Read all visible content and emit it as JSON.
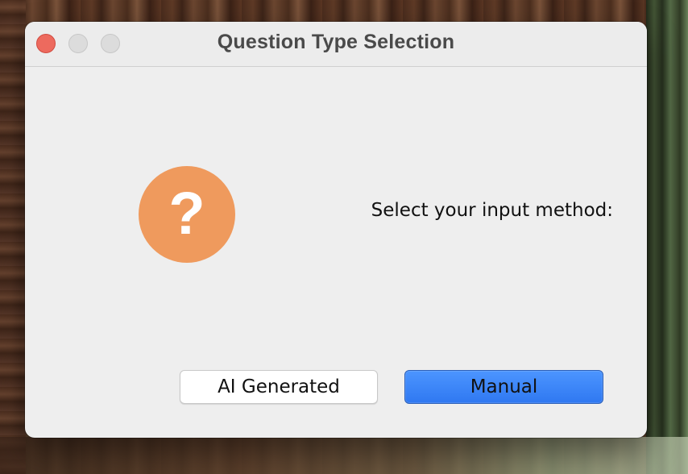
{
  "window": {
    "title": "Question Type Selection"
  },
  "dialog": {
    "icon": "question-icon",
    "icon_glyph": "?",
    "icon_color": "#ef9a5d",
    "prompt": "Select your input method:",
    "buttons": {
      "ai_label": "AI Generated",
      "manual_label": "Manual"
    },
    "default_button": "Manual",
    "accent_color": "#3b82f6"
  }
}
